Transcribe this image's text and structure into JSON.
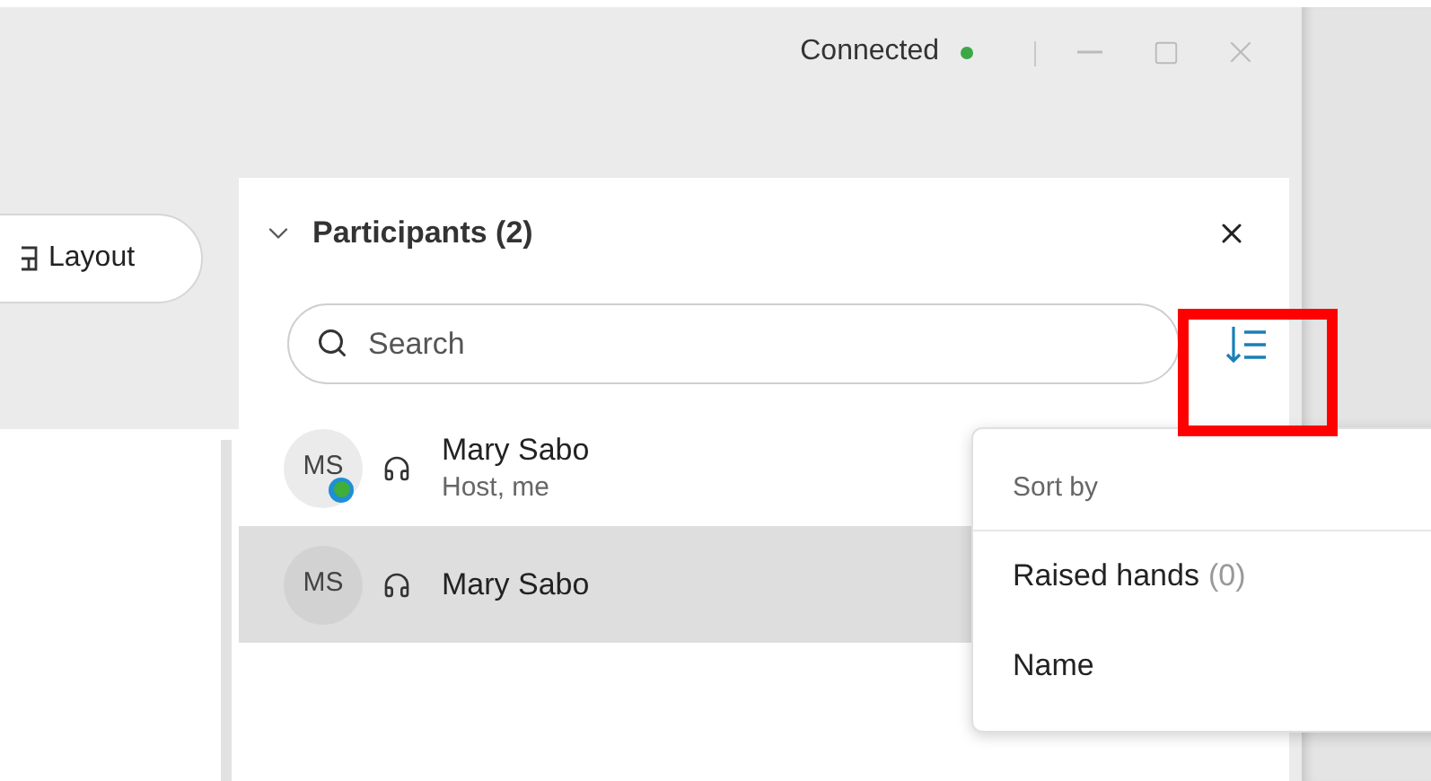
{
  "window": {
    "status": "Connected",
    "connected": true
  },
  "layout_button": {
    "label": "Layout"
  },
  "panel": {
    "title": "Participants (2)",
    "expanded": true,
    "search": {
      "placeholder": "Search"
    },
    "participants": [
      {
        "initials": "MS",
        "name": "Mary Sabo",
        "role": "Host, me",
        "badge": true,
        "selected": false
      },
      {
        "initials": "MS",
        "name": "Mary Sabo",
        "badge": false,
        "selected": true
      }
    ]
  },
  "sort_menu": {
    "heading": "Sort by",
    "items": [
      {
        "label": "Raised hands",
        "count": "(0)"
      },
      {
        "label": "Name"
      }
    ]
  },
  "annotation": {
    "highlight": true
  }
}
